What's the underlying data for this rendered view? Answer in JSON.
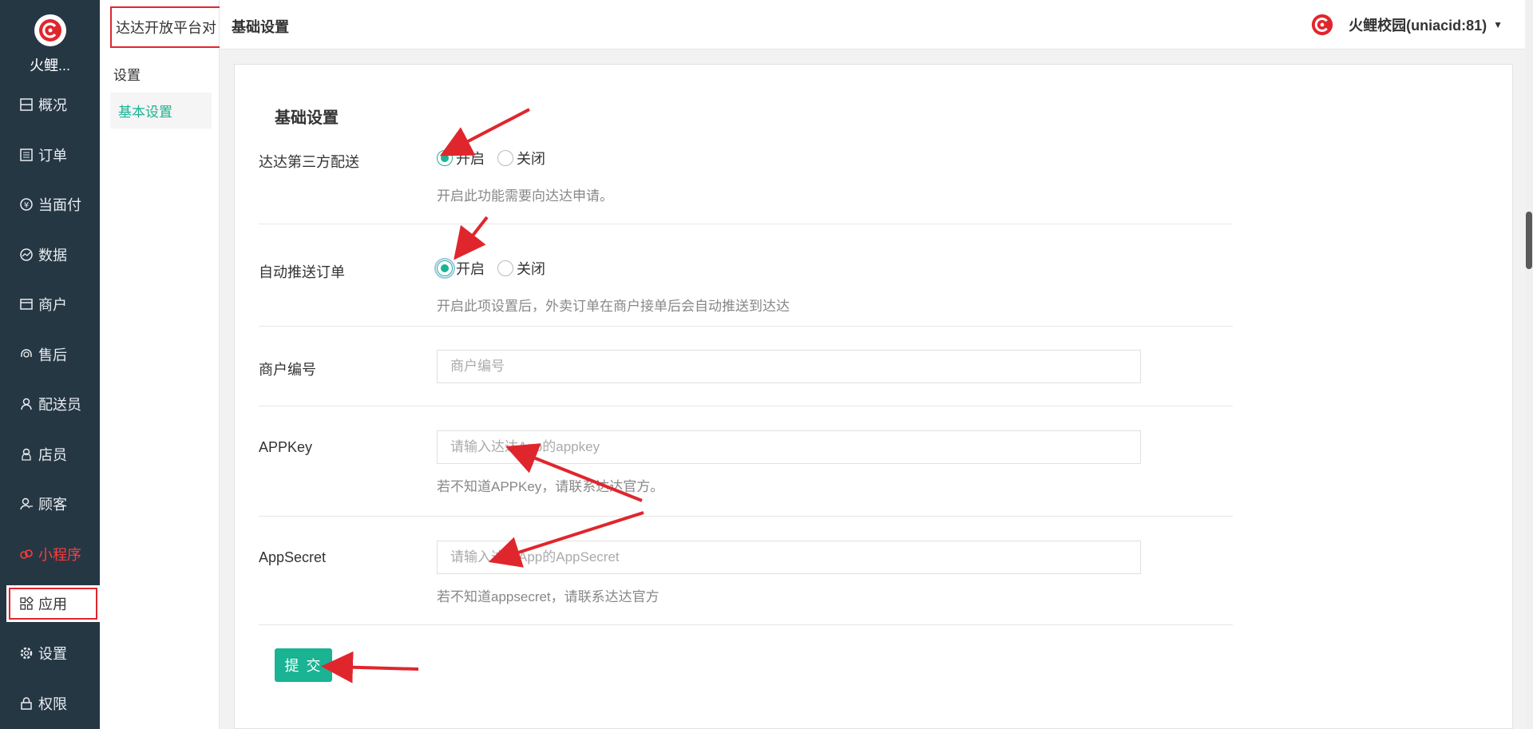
{
  "sidebar": {
    "brand_name": "火鲤...",
    "items": [
      {
        "label": "概况",
        "icon": "dashboard-icon"
      },
      {
        "label": "订单",
        "icon": "list-icon"
      },
      {
        "label": "当面付",
        "icon": "yen-icon"
      },
      {
        "label": "数据",
        "icon": "chart-icon"
      },
      {
        "label": "商户",
        "icon": "store-icon"
      },
      {
        "label": "售后",
        "icon": "headset-icon"
      },
      {
        "label": "配送员",
        "icon": "user-icon"
      },
      {
        "label": "店员",
        "icon": "staff-icon"
      },
      {
        "label": "顾客",
        "icon": "customer-icon"
      },
      {
        "label": "小程序",
        "icon": "miniapp-icon"
      },
      {
        "label": "应用",
        "icon": "apps-icon"
      },
      {
        "label": "设置",
        "icon": "gear-icon"
      },
      {
        "label": "权限",
        "icon": "lock-icon"
      }
    ],
    "accent_color": "#ff3b3b"
  },
  "subnav": {
    "title": "达达开放平台对",
    "group_label": "设置",
    "active_item": "基本设置"
  },
  "header": {
    "crumb": "基础设置",
    "account": "火鲤校园(uniacid:81)"
  },
  "form": {
    "title": "基础设置",
    "rows": {
      "third_party": {
        "label": "达达第三方配送",
        "options": [
          "开启",
          "关闭"
        ],
        "selected": "开启",
        "help": "开启此功能需要向达达申请。"
      },
      "auto_push": {
        "label": "自动推送订单",
        "options": [
          "开启",
          "关闭"
        ],
        "selected": "开启",
        "help": "开启此项设置后，外卖订单在商户接单后会自动推送到达达"
      },
      "merchant_no": {
        "label": "商户编号",
        "placeholder": "商户编号"
      },
      "app_key": {
        "label": "APPKey",
        "placeholder": "请输入达达App的appkey",
        "help": "若不知道APPKey，请联系达达官方。"
      },
      "app_secret": {
        "label": "AppSecret",
        "placeholder": "请输入达达App的AppSecret",
        "help": "若不知道appsecret，请联系达达官方"
      }
    },
    "submit_label": "提 交",
    "primary_color": "#1ab394"
  }
}
